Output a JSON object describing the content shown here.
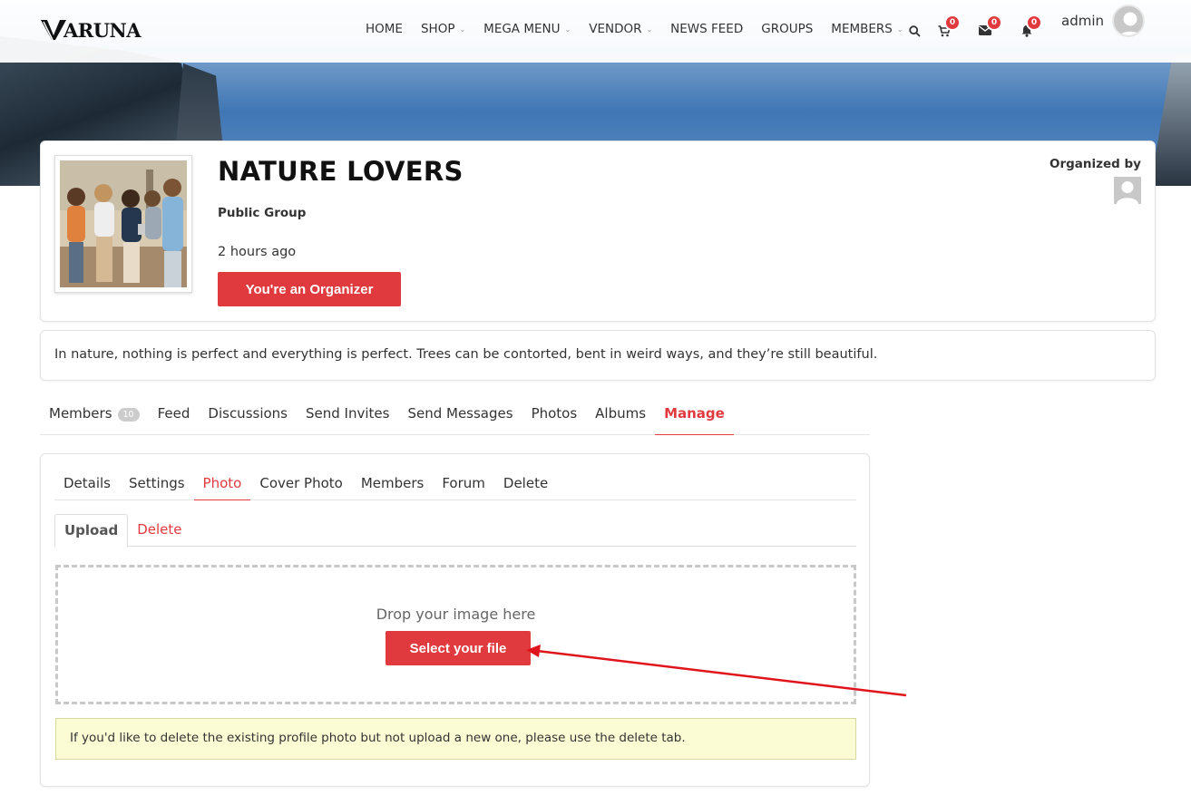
{
  "header": {
    "logo_text": "ARUNA",
    "nav": [
      {
        "label": "HOME",
        "has_caret": false
      },
      {
        "label": "SHOP",
        "has_caret": true
      },
      {
        "label": "MEGA MENU",
        "has_caret": true
      },
      {
        "label": "VENDOR",
        "has_caret": true
      },
      {
        "label": "NEWS FEED",
        "has_caret": false
      },
      {
        "label": "GROUPS",
        "has_caret": false
      },
      {
        "label": "MEMBERS",
        "has_caret": true
      }
    ],
    "cart_count": "0",
    "messages_count": "0",
    "notifications_count": "0",
    "username": "admin"
  },
  "group": {
    "title": "NATURE LOVERS",
    "type": "Public Group",
    "last_active": "2 hours ago",
    "organizer_button": "You're an Organizer",
    "organized_by_label": "Organized by",
    "description": "In nature, nothing is perfect and everything is perfect. Trees can be contorted, bent in weird ways, and they’re still beautiful."
  },
  "main_tabs": {
    "members": "Members",
    "members_count": "10",
    "feed": "Feed",
    "discussions": "Discussions",
    "send_invites": "Send Invites",
    "send_messages": "Send Messages",
    "photos": "Photos",
    "albums": "Albums",
    "manage": "Manage"
  },
  "manage_tabs": {
    "details": "Details",
    "settings": "Settings",
    "photo": "Photo",
    "cover_photo": "Cover Photo",
    "members": "Members",
    "forum": "Forum",
    "delete": "Delete"
  },
  "upload_tabs": {
    "upload": "Upload",
    "delete": "Delete"
  },
  "dropzone": {
    "text": "Drop your image here",
    "button": "Select your file"
  },
  "notice": "If you'd like to delete the existing profile photo but not upload a new one, please use the delete tab.",
  "colors": {
    "accent": "#e03a3e",
    "notice_bg": "#fcfcd4"
  }
}
